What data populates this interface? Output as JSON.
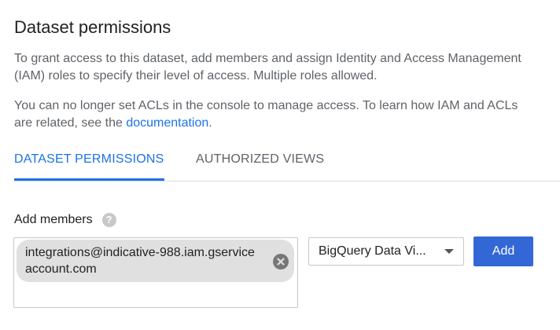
{
  "header": {
    "title": "Dataset permissions"
  },
  "description": {
    "paragraph1": "To grant access to this dataset, add members and assign Identity and Access Management (IAM) roles to specify their level of access. Multiple roles allowed.",
    "paragraph2_prefix": "You can no longer set ACLs in the console to manage access. To learn how IAM and ACLs are related, see the ",
    "paragraph2_link": "documentation",
    "paragraph2_suffix": "."
  },
  "tabs": [
    {
      "label": "DATASET PERMISSIONS",
      "active": true
    },
    {
      "label": "AUTHORIZED VIEWS",
      "active": false
    }
  ],
  "add_members": {
    "label": "Add members",
    "help_icon": "help-circle-icon",
    "members": [
      {
        "value": "integrations@indicative-988.iam.gserviceaccount.com",
        "remove_icon": "cancel-circle-icon"
      }
    ],
    "role": {
      "selected": "BigQuery Data Vi..."
    },
    "add_button_label": "Add"
  },
  "colors": {
    "accent": "#1a73e8",
    "button": "#3367d6",
    "chip": "#e0e0e0"
  }
}
